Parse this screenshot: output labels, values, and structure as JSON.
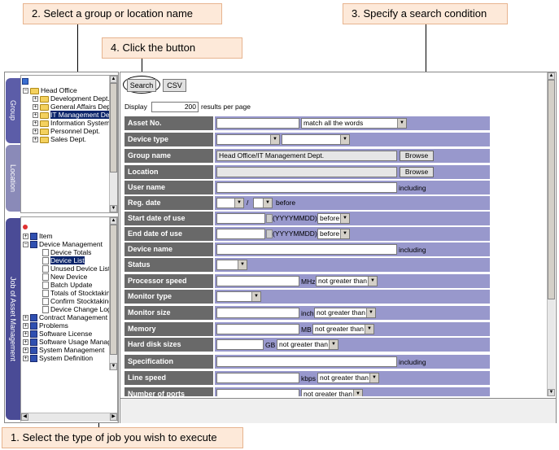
{
  "callouts": {
    "step1": "1. Select the type of job you wish to execute",
    "step2": "2. Select a group or location name",
    "step3": "3. Specify a search condition",
    "step4": "4. Click the button"
  },
  "tabs": {
    "group": "Group",
    "location": "Location",
    "job": "Job of Asset Management"
  },
  "group_tree": [
    {
      "label": "Head Office",
      "expander": "−"
    },
    {
      "label": "Development Dept.",
      "expander": "+"
    },
    {
      "label": "General Affairs Dep",
      "expander": "+"
    },
    {
      "label": "IT Management Dep",
      "expander": "+",
      "selected": true
    },
    {
      "label": "Information System",
      "expander": "+"
    },
    {
      "label": "Personnel Dept.",
      "expander": "+"
    },
    {
      "label": "Sales Dept.",
      "expander": "+"
    }
  ],
  "job_tree": {
    "item": "Item",
    "device_management": "Device Management",
    "device_children": [
      "Device Totals",
      "Device List",
      "Unused Device List",
      "New Device",
      "Batch Update",
      "Totals of Stocktakin",
      "Confirm Stocktaking",
      "Device Change Log"
    ],
    "others": [
      "Contract Management",
      "Problems",
      "Software License",
      "Software Usage Manag",
      "System Management",
      "System Definition"
    ]
  },
  "toolbar": {
    "search": "Search",
    "csv": "CSV"
  },
  "display": {
    "label": "Display",
    "value": "200",
    "suffix": "results per page"
  },
  "fields": {
    "asset_no": {
      "label": "Asset No.",
      "option": "match all the words"
    },
    "device_type": {
      "label": "Device type"
    },
    "group_name": {
      "label": "Group name",
      "value": "Head Office/IT Management Dept.",
      "button": "Browse"
    },
    "location": {
      "label": "Location",
      "button": "Browse"
    },
    "user_name": {
      "label": "User name",
      "suffix": "including"
    },
    "reg_date": {
      "label": "Reg. date",
      "sep": "/",
      "suffix": "before"
    },
    "start_date": {
      "label": "Start date of use",
      "format": "(YYYYMMDD)",
      "option": "before"
    },
    "end_date": {
      "label": "End date of use",
      "format": "(YYYYMMDD)",
      "option": "before"
    },
    "device_name": {
      "label": "Device name",
      "suffix": "including"
    },
    "status": {
      "label": "Status"
    },
    "processor": {
      "label": "Processor speed",
      "unit": "MHz",
      "option": "not greater than"
    },
    "monitor_type": {
      "label": "Monitor type"
    },
    "monitor_size": {
      "label": "Monitor size",
      "unit": "inch",
      "option": "not greater than"
    },
    "memory": {
      "label": "Memory",
      "unit": "MB",
      "option": "not greater than"
    },
    "hdd": {
      "label": "Hard disk sizes",
      "unit": "GB",
      "option": "not greater than"
    },
    "spec": {
      "label": "Specification",
      "suffix": "including"
    },
    "line_speed": {
      "label": "Line speed",
      "unit": "kbps",
      "option": "not greater than"
    },
    "ports": {
      "label": "Number of ports",
      "option": "not greater than"
    }
  }
}
